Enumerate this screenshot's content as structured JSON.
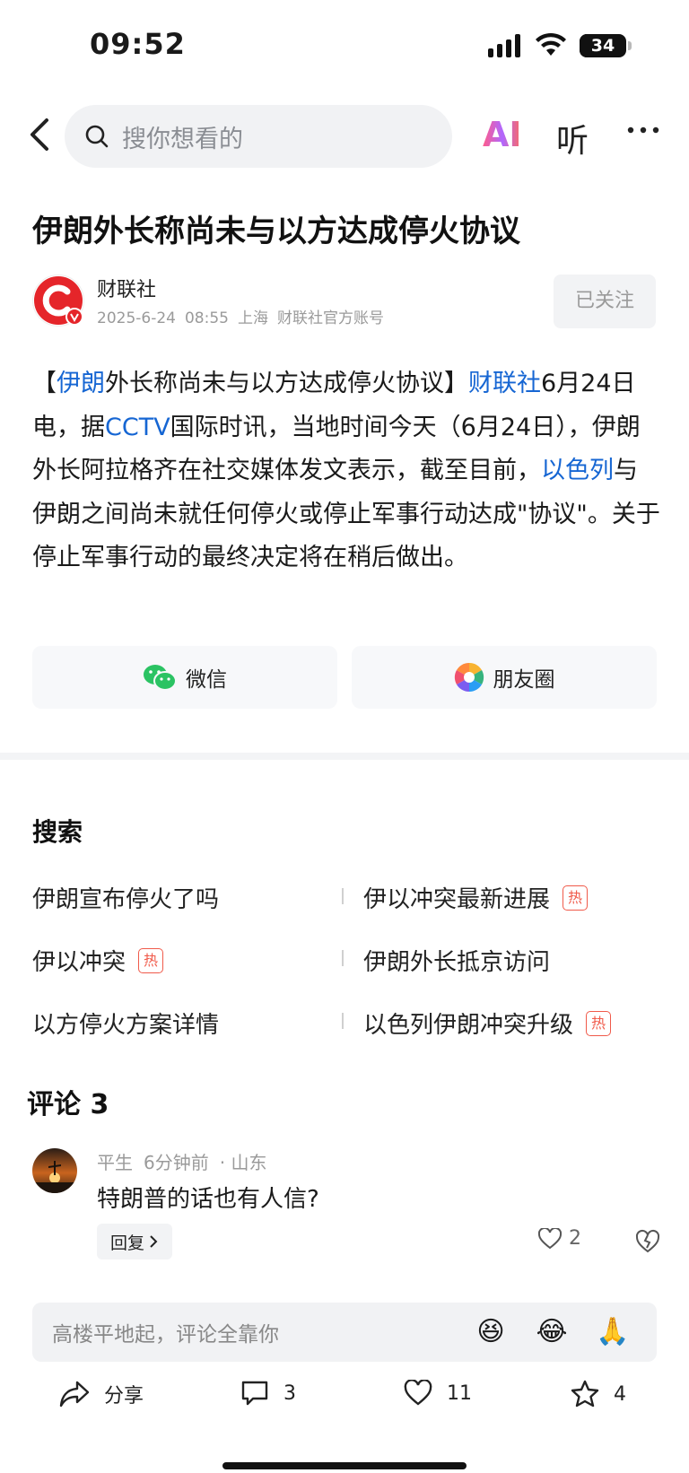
{
  "status_bar": {
    "time": "09:52",
    "battery": "34"
  },
  "nav": {
    "search_placeholder": "搜你想看的",
    "ai_label": "AI",
    "listen_label": "听"
  },
  "article": {
    "title": "伊朗外长称尚未与以方达成停火协议",
    "source": {
      "name": "财联社",
      "date": "2025-6-24",
      "time": "08:55",
      "location": "上海",
      "account_type": "财联社官方账号",
      "follow_label": "已关注"
    },
    "body": {
      "p1": "【",
      "link1": "伊朗",
      "p2": "外长称尚未与以方达成停火协议】",
      "link2": "财联社",
      "p3": "6月24日电，据",
      "link3": "CCTV",
      "p4": "国际时讯，当地时间今天（6月24日），伊朗外长阿拉格齐在社交媒体发文表示，截至目前，",
      "link4": "以色列",
      "p5": "与伊朗之间尚未就任何停火或停止军事行动达成\"协议\"。关于停止军事行动的最终决定将在稍后做出。"
    },
    "share": {
      "wechat": "微信",
      "moments": "朋友圈"
    }
  },
  "search_section": {
    "title": "搜索",
    "hot_badge": "热",
    "items": [
      {
        "text": "伊朗宣布停火了吗",
        "hot": false
      },
      {
        "text": "伊以冲突最新进展",
        "hot": true
      },
      {
        "text": "伊以冲突",
        "hot": true
      },
      {
        "text": "伊朗外长抵京访问",
        "hot": false
      },
      {
        "text": "以方停火方案详情",
        "hot": false
      },
      {
        "text": "以色列伊朗冲突升级",
        "hot": true
      }
    ]
  },
  "comments": {
    "title": "评论 3",
    "list": [
      {
        "user": "平生",
        "time": "6分钟前",
        "location": "· 山东",
        "text": "特朗普的话也有人信?",
        "reply_label": "回复",
        "likes": "2"
      }
    ],
    "input_placeholder": "高楼平地起，评论全靠你",
    "emojis": [
      "😆",
      "😂",
      "🙏"
    ]
  },
  "bottom_bar": {
    "share_label": "分享",
    "comments_count": "3",
    "likes_count": "11",
    "favorites_count": "4"
  }
}
